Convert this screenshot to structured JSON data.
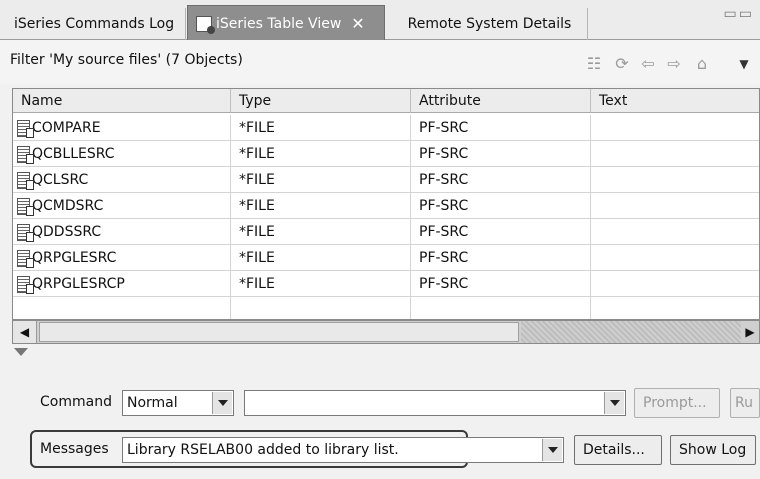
{
  "tabs": [
    {
      "label": "iSeries Commands Log"
    },
    {
      "label": "iSeries Table View"
    },
    {
      "label": "Remote System Details"
    }
  ],
  "filter": {
    "label": "Filter 'My source files' (7 Objects)"
  },
  "table": {
    "columns": [
      "Name",
      "Type",
      "Attribute",
      "Text"
    ],
    "rows": [
      {
        "name": "COMPARE",
        "type": "*FILE",
        "attribute": "PF-SRC",
        "text": ""
      },
      {
        "name": "QCBLLESRC",
        "type": "*FILE",
        "attribute": "PF-SRC",
        "text": ""
      },
      {
        "name": "QCLSRC",
        "type": "*FILE",
        "attribute": "PF-SRC",
        "text": ""
      },
      {
        "name": "QCMDSRC",
        "type": "*FILE",
        "attribute": "PF-SRC",
        "text": ""
      },
      {
        "name": "QDDSSRC",
        "type": "*FILE",
        "attribute": "PF-SRC",
        "text": ""
      },
      {
        "name": "QRPGLESRC",
        "type": "*FILE",
        "attribute": "PF-SRC",
        "text": ""
      },
      {
        "name": "QRPGLESRCP",
        "type": "*FILE",
        "attribute": "PF-SRC",
        "text": ""
      }
    ]
  },
  "command": {
    "label": "Command",
    "mode_value": "Normal",
    "input_value": "",
    "prompt_label": "Prompt...",
    "run_label": "Ru"
  },
  "messages": {
    "label": "Messages",
    "value": "Library RSELAB00 added to library list.",
    "details_label": "Details...",
    "showlog_label": "Show Log"
  },
  "icons": {
    "tab_close": "close-icon",
    "file": "source-file-icon",
    "toolbar": [
      "filter-icon",
      "refresh-icon",
      "back-icon",
      "forward-icon",
      "home-icon",
      "view-menu-icon"
    ]
  }
}
